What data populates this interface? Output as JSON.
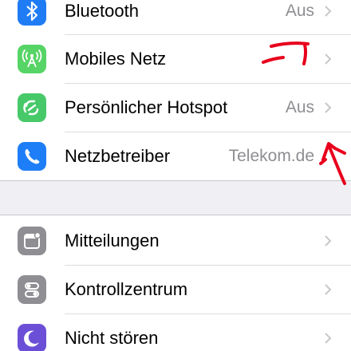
{
  "colors": {
    "bluetooth": "#1f7cf5",
    "mobile": "#57d466",
    "hotspot": "#47c96a",
    "carrier": "#1e7ef7",
    "notifications": "#8e8e93",
    "control_center": "#8e8e93",
    "dnd": "#6b4fd6",
    "annotation": "#e8001c"
  },
  "settings": {
    "group1": [
      {
        "label": "Bluetooth",
        "value": "Aus",
        "icon": "bluetooth-icon"
      },
      {
        "label": "Mobiles Netz",
        "value": "",
        "icon": "antenna-icon"
      },
      {
        "label": "Persönlicher Hotspot",
        "value": "Aus",
        "icon": "hotspot-icon"
      },
      {
        "label": "Netzbetreiber",
        "value": "Telekom.de",
        "icon": "phone-icon"
      }
    ],
    "group2": [
      {
        "label": "Mitteilungen",
        "value": "",
        "icon": "notifications-icon"
      },
      {
        "label": "Kontrollzentrum",
        "value": "",
        "icon": "control-center-icon"
      },
      {
        "label": "Nicht stören",
        "value": "",
        "icon": "moon-icon"
      }
    ]
  }
}
